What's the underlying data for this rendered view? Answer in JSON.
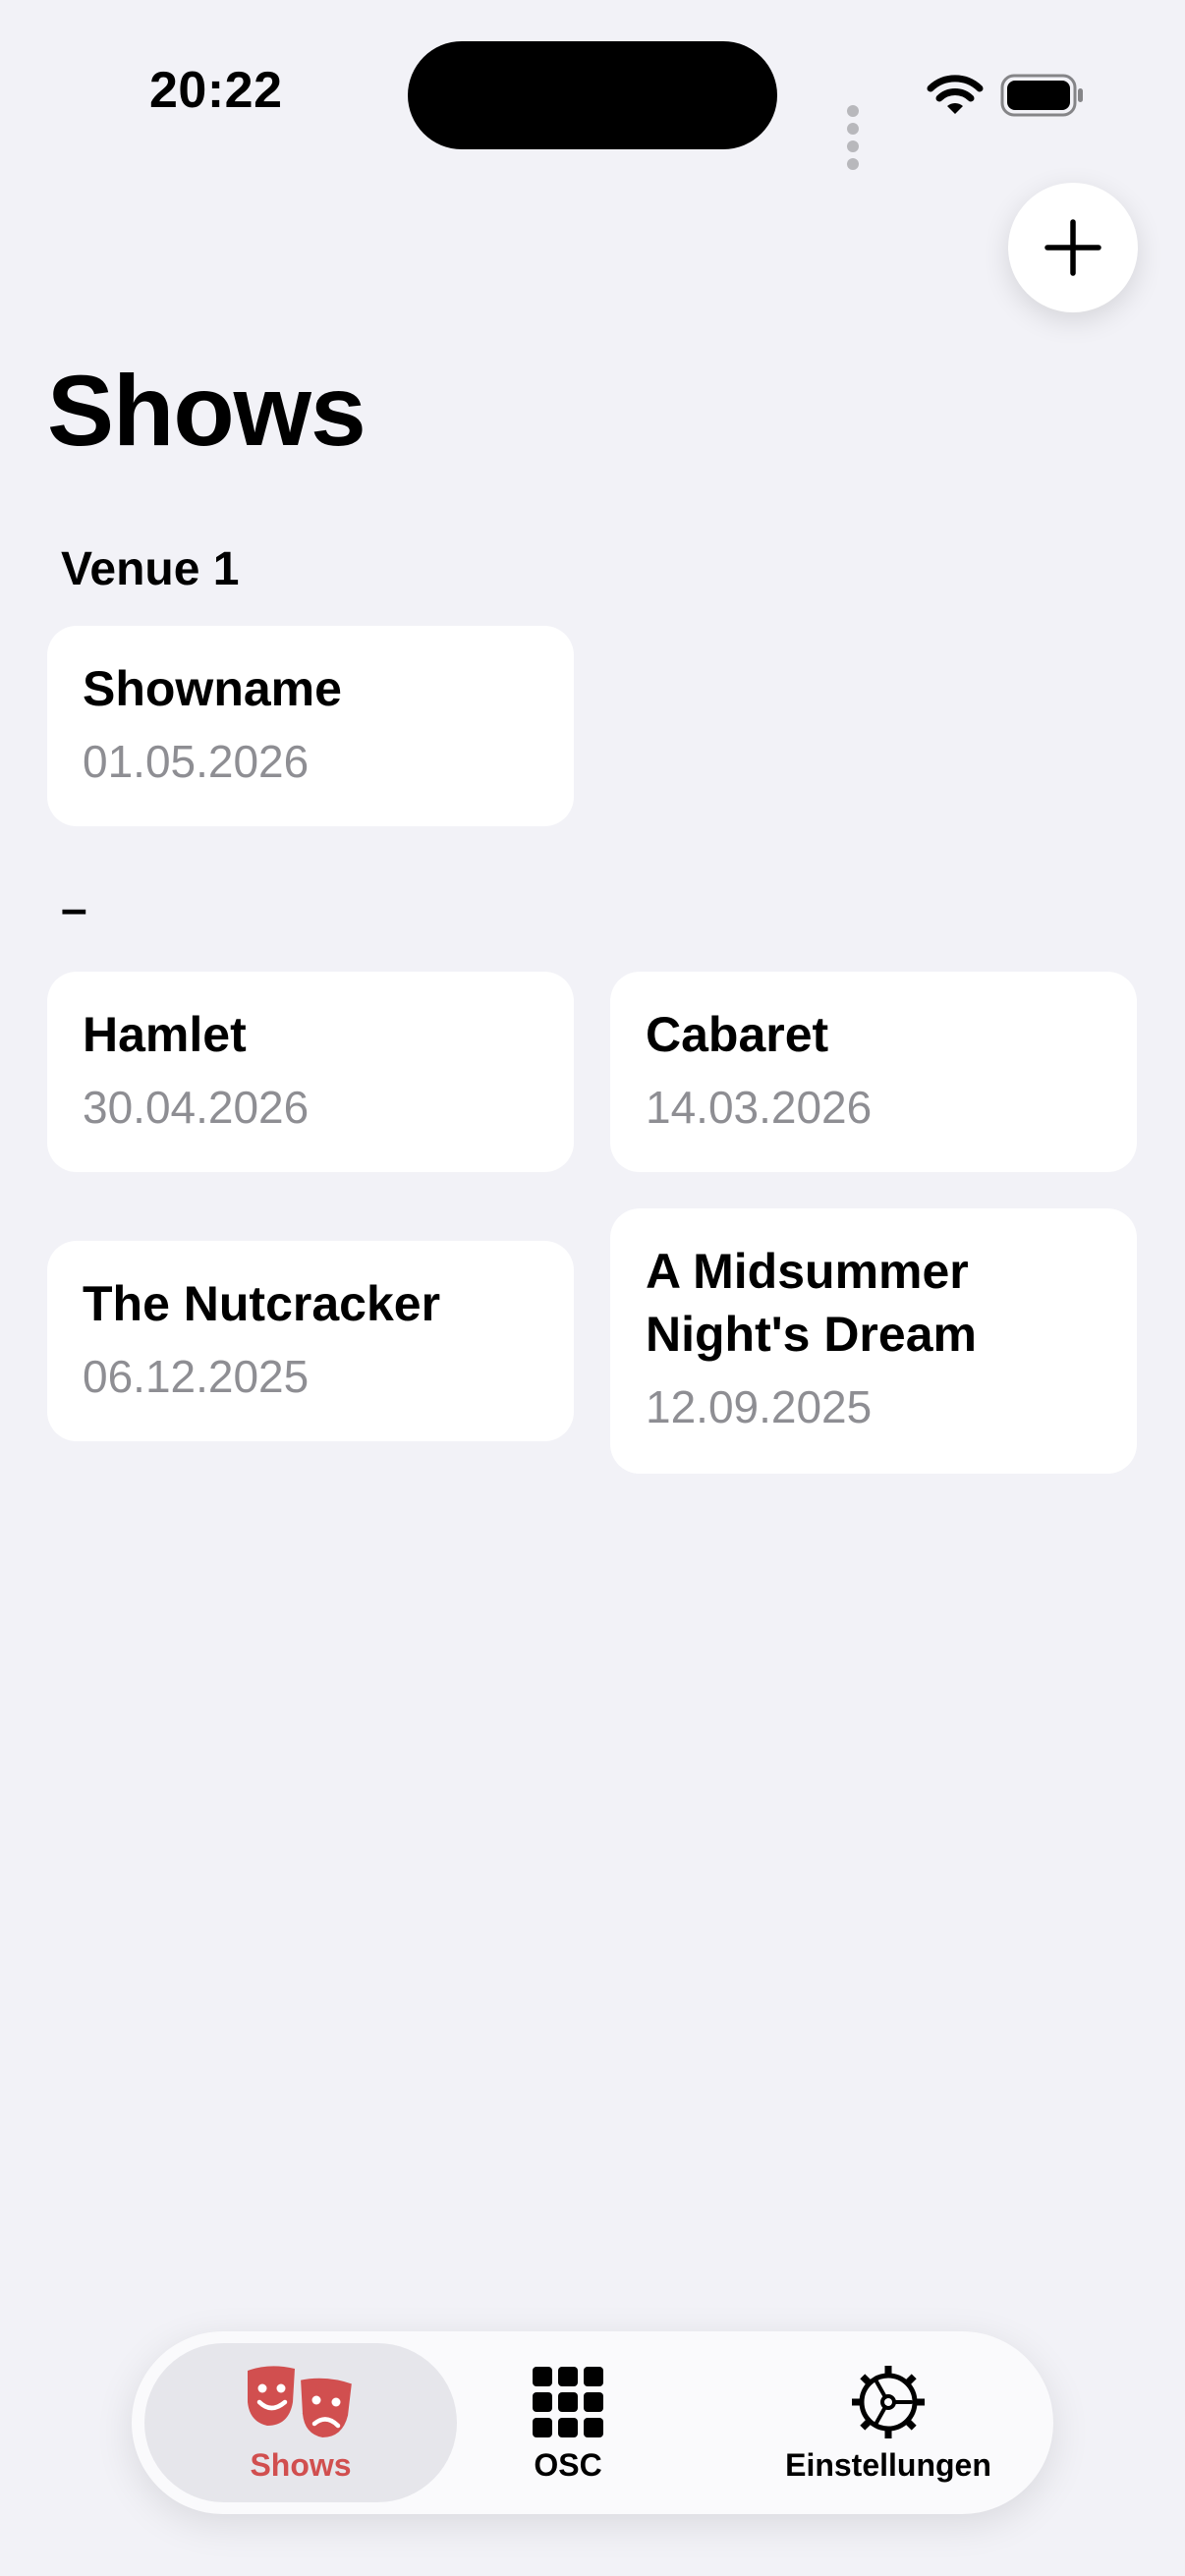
{
  "status_bar": {
    "time": "20:22"
  },
  "header": {
    "title": "Shows"
  },
  "toolbar": {
    "add_icon": "plus-icon"
  },
  "sections": [
    {
      "header": "Venue 1",
      "shows": [
        {
          "name": "Showname",
          "date": "01.05.2026"
        }
      ]
    },
    {
      "header": "–",
      "shows": [
        {
          "name": "Hamlet",
          "date": "30.04.2026"
        },
        {
          "name": "Cabaret",
          "date": "14.03.2026"
        },
        {
          "name": "The Nutcracker",
          "date": "06.12.2025"
        },
        {
          "name": "A Midsummer Night's Dream",
          "date": "12.09.2025"
        }
      ]
    }
  ],
  "tab_bar": {
    "tabs": [
      {
        "label": "Shows",
        "icon": "theater-masks-icon",
        "active": true
      },
      {
        "label": "OSC",
        "icon": "grid-icon",
        "active": false
      },
      {
        "label": "Einstellungen",
        "icon": "gear-icon",
        "active": false
      }
    ]
  },
  "colors": {
    "background": "#F2F2F7",
    "card": "#FFFFFF",
    "secondary_text": "#8E8E93",
    "accent": "#D14F4F"
  }
}
